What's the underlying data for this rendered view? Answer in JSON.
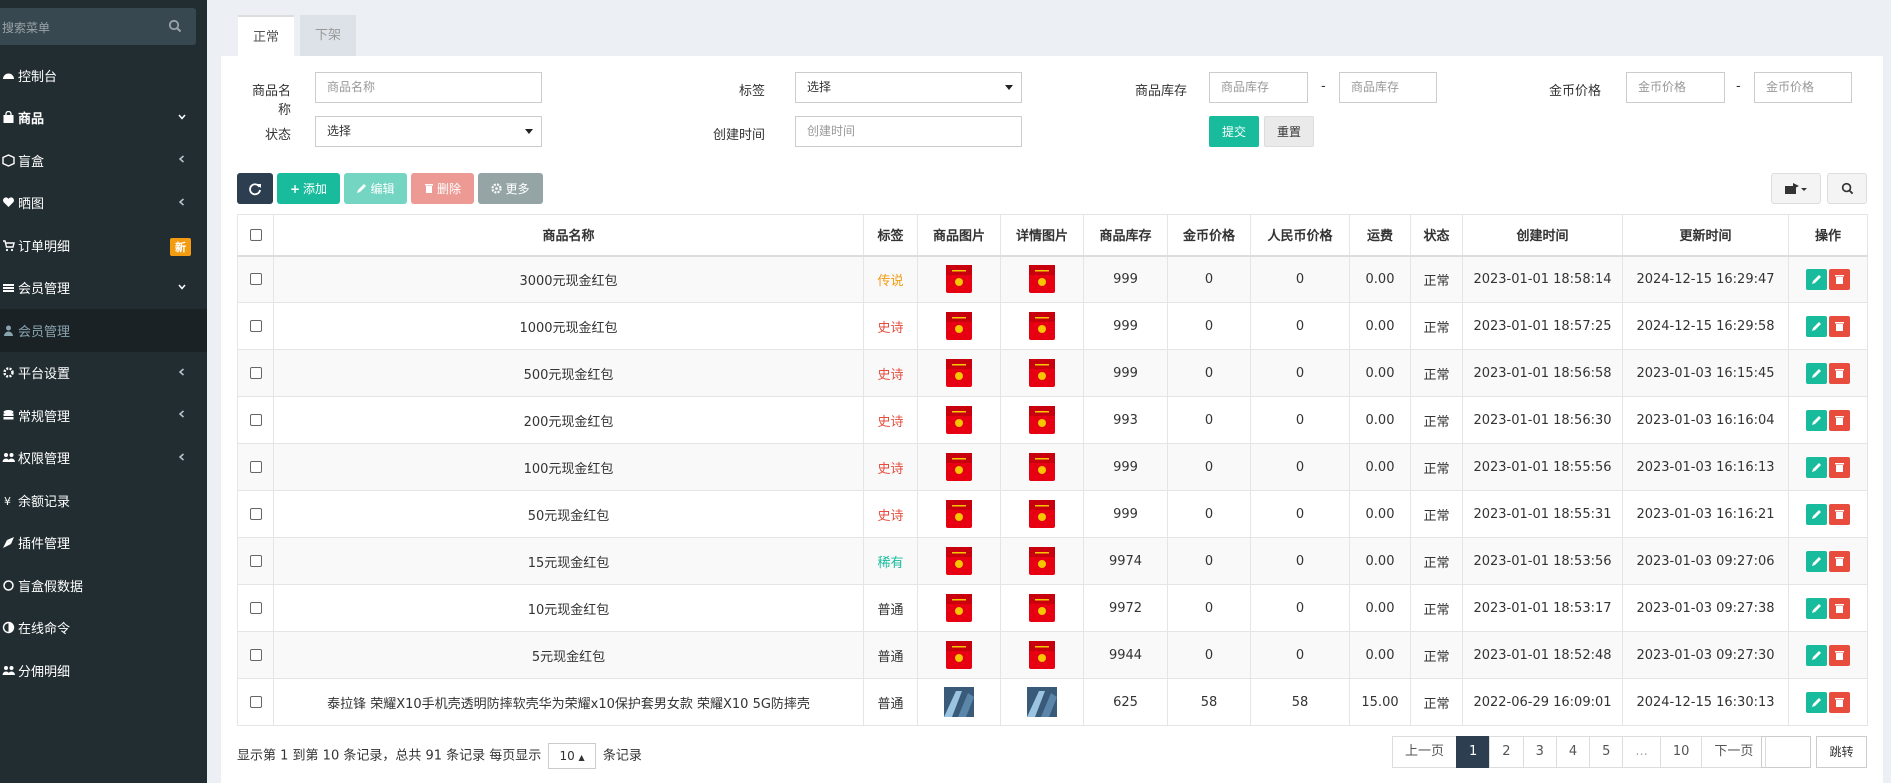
{
  "sidebar": {
    "search_placeholder": "搜索菜单",
    "items": [
      {
        "label": "控制台",
        "icon": "dashboard-icon",
        "arrow": ""
      },
      {
        "label": "商品",
        "icon": "shopping-bag-icon",
        "arrow": "down"
      },
      {
        "label": "盲盒",
        "icon": "cube-icon",
        "arrow": "left"
      },
      {
        "label": "晒图",
        "icon": "heart-icon",
        "arrow": "left"
      },
      {
        "label": "订单明细",
        "icon": "cart-icon",
        "arrow": "",
        "badge": "新"
      },
      {
        "label": "会员管理",
        "icon": "group-icon",
        "arrow": "down"
      },
      {
        "label": "会员管理",
        "icon": "user-icon",
        "arrow": "",
        "sub": true
      },
      {
        "label": "平台设置",
        "icon": "cog-icon",
        "arrow": "left"
      },
      {
        "label": "常规管理",
        "icon": "database-icon",
        "arrow": "left"
      },
      {
        "label": "权限管理",
        "icon": "users-icon",
        "arrow": "left"
      },
      {
        "label": "余额记录",
        "icon": "yen-icon",
        "arrow": ""
      },
      {
        "label": "插件管理",
        "icon": "rocket-icon",
        "arrow": ""
      },
      {
        "label": "盲盒假数据",
        "icon": "circle-icon",
        "arrow": ""
      },
      {
        "label": "在线命令",
        "icon": "adjust-icon",
        "arrow": ""
      },
      {
        "label": "分佣明细",
        "icon": "users-icon",
        "arrow": ""
      }
    ]
  },
  "tabs": {
    "normal": "正常",
    "offshelf": "下架"
  },
  "filters": {
    "name_label": "商品名称",
    "name_placeholder": "商品名称",
    "tag_label": "标签",
    "tag_value": "选择",
    "stock_label": "商品库存",
    "stock_min_ph": "商品库存",
    "stock_max_ph": "商品库存",
    "coin_label": "金币价格",
    "coin_min_ph": "金币价格",
    "coin_max_ph": "金币价格",
    "status_label": "状态",
    "status_value": "选择",
    "created_label": "创建时间",
    "created_placeholder": "创建时间",
    "dash": "-",
    "submit": "提交",
    "reset": "重置"
  },
  "toolbar": {
    "add": "添加",
    "edit": "编辑",
    "delete": "删除",
    "more": "更多"
  },
  "table": {
    "headers": [
      "商品名称",
      "标签",
      "商品图片",
      "详情图片",
      "商品库存",
      "金币价格",
      "人民币价格",
      "运费",
      "状态",
      "创建时间",
      "更新时间",
      "操作"
    ],
    "rows": [
      {
        "name": "3000元现金红包",
        "tag": "传说",
        "tag_color": "#f39c12",
        "stock": "999",
        "coin": "0",
        "rmb": "0",
        "freight": "0.00",
        "status": "正常",
        "created": "2023-01-01 18:58:14",
        "updated": "2024-12-15 16:29:47",
        "img": "redpacket"
      },
      {
        "name": "1000元现金红包",
        "tag": "史诗",
        "tag_color": "#e74c3c",
        "stock": "999",
        "coin": "0",
        "rmb": "0",
        "freight": "0.00",
        "status": "正常",
        "created": "2023-01-01 18:57:25",
        "updated": "2024-12-15 16:29:58",
        "img": "redpacket"
      },
      {
        "name": "500元现金红包",
        "tag": "史诗",
        "tag_color": "#e74c3c",
        "stock": "999",
        "coin": "0",
        "rmb": "0",
        "freight": "0.00",
        "status": "正常",
        "created": "2023-01-01 18:56:58",
        "updated": "2023-01-03 16:15:45",
        "img": "redpacket"
      },
      {
        "name": "200元现金红包",
        "tag": "史诗",
        "tag_color": "#e74c3c",
        "stock": "993",
        "coin": "0",
        "rmb": "0",
        "freight": "0.00",
        "status": "正常",
        "created": "2023-01-01 18:56:30",
        "updated": "2023-01-03 16:16:04",
        "img": "redpacket"
      },
      {
        "name": "100元现金红包",
        "tag": "史诗",
        "tag_color": "#e74c3c",
        "stock": "999",
        "coin": "0",
        "rmb": "0",
        "freight": "0.00",
        "status": "正常",
        "created": "2023-01-01 18:55:56",
        "updated": "2023-01-03 16:16:13",
        "img": "redpacket"
      },
      {
        "name": "50元现金红包",
        "tag": "史诗",
        "tag_color": "#e74c3c",
        "stock": "999",
        "coin": "0",
        "rmb": "0",
        "freight": "0.00",
        "status": "正常",
        "created": "2023-01-01 18:55:31",
        "updated": "2023-01-03 16:16:21",
        "img": "redpacket"
      },
      {
        "name": "15元现金红包",
        "tag": "稀有",
        "tag_color": "#18bc9c",
        "stock": "9974",
        "coin": "0",
        "rmb": "0",
        "freight": "0.00",
        "status": "正常",
        "created": "2023-01-01 18:53:56",
        "updated": "2023-01-03 09:27:06",
        "img": "redpacket"
      },
      {
        "name": "10元现金红包",
        "tag": "普通",
        "tag_color": "#333333",
        "stock": "9972",
        "coin": "0",
        "rmb": "0",
        "freight": "0.00",
        "status": "正常",
        "created": "2023-01-01 18:53:17",
        "updated": "2023-01-03 09:27:38",
        "img": "redpacket"
      },
      {
        "name": "5元现金红包",
        "tag": "普通",
        "tag_color": "#333333",
        "stock": "9944",
        "coin": "0",
        "rmb": "0",
        "freight": "0.00",
        "status": "正常",
        "created": "2023-01-01 18:52:48",
        "updated": "2023-01-03 09:27:30",
        "img": "redpacket"
      },
      {
        "name": "泰拉锋 荣耀X10手机壳透明防摔软壳华为荣耀x10保护套男女款 荣耀X10 5G防摔壳",
        "tag": "普通",
        "tag_color": "#333333",
        "stock": "625",
        "coin": "58",
        "rmb": "58",
        "freight": "15.00",
        "status": "正常",
        "created": "2022-06-29 16:09:01",
        "updated": "2024-12-15 16:30:13",
        "img": "phonecase"
      }
    ]
  },
  "footer": {
    "prefix": "显示第 1 到第 10 条记录，总共 91 条记录 每页显示",
    "page_size": "10",
    "suffix": "条记录"
  },
  "pager": {
    "prev": "上一页",
    "pages": [
      "1",
      "2",
      "3",
      "4",
      "5",
      "...",
      "10"
    ],
    "next": "下一页",
    "jump": "跳转"
  },
  "colors": {
    "sidebar_bg": "#222d32",
    "accent": "#18bc9c",
    "danger": "#e74c3c",
    "dark": "#2c3e50"
  }
}
